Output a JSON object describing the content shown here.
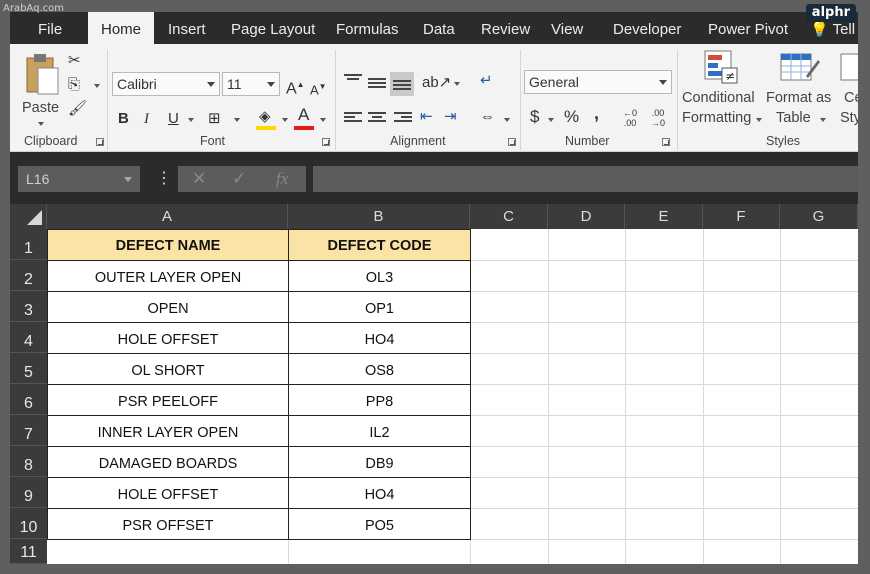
{
  "watermark": "ArabAq.com",
  "brand": "alphr",
  "tabs": [
    "File",
    "Home",
    "Insert",
    "Page Layout",
    "Formulas",
    "Data",
    "Review",
    "View",
    "Developer",
    "Power Pivot",
    "Tell"
  ],
  "ribbon": {
    "clipboard": {
      "paste": "Paste",
      "label": "Clipboard"
    },
    "font": {
      "name": "Calibri",
      "size": "11",
      "grow": "A",
      "shrink": "A",
      "bold": "B",
      "italic": "I",
      "underline": "U",
      "color_letter": "A",
      "label": "Font",
      "highlight_color": "#ffd800",
      "font_color": "#e11c1c"
    },
    "alignment": {
      "label": "Alignment"
    },
    "number": {
      "format": "General",
      "currency": "$",
      "percent": "%",
      "comma": ",",
      "inc_decimal": "←0 .00",
      "dec_decimal": ".00 →0",
      "label": "Number"
    },
    "styles": {
      "cond_line1": "Conditional",
      "cond_line2": "Formatting",
      "table_line1": "Format as",
      "table_line2": "Table",
      "cell_line1": "Ce",
      "cell_line2": "Styl",
      "label": "Styles"
    }
  },
  "formula_bar": {
    "name_box": "L16",
    "cancel": "✕",
    "enter": "✓",
    "fx": "fx",
    "formula": ""
  },
  "columns": [
    "A",
    "B",
    "C",
    "D",
    "E",
    "F",
    "G"
  ],
  "rows": [
    "1",
    "2",
    "3",
    "4",
    "5",
    "6",
    "7",
    "8",
    "9",
    "10",
    "11"
  ],
  "table": {
    "headers": [
      "DEFECT NAME",
      "DEFECT CODE"
    ],
    "header_fill": "#fbe3a6",
    "rows": [
      [
        "OUTER LAYER OPEN",
        "OL3"
      ],
      [
        "OPEN",
        "OP1"
      ],
      [
        "HOLE OFFSET",
        "HO4"
      ],
      [
        "OL SHORT",
        "OS8"
      ],
      [
        "PSR PEELOFF",
        "PP8"
      ],
      [
        "INNER LAYER OPEN",
        "IL2"
      ],
      [
        "DAMAGED BOARDS",
        "DB9"
      ],
      [
        "HOLE OFFSET",
        "HO4"
      ],
      [
        "PSR OFFSET",
        "PO5"
      ]
    ]
  }
}
